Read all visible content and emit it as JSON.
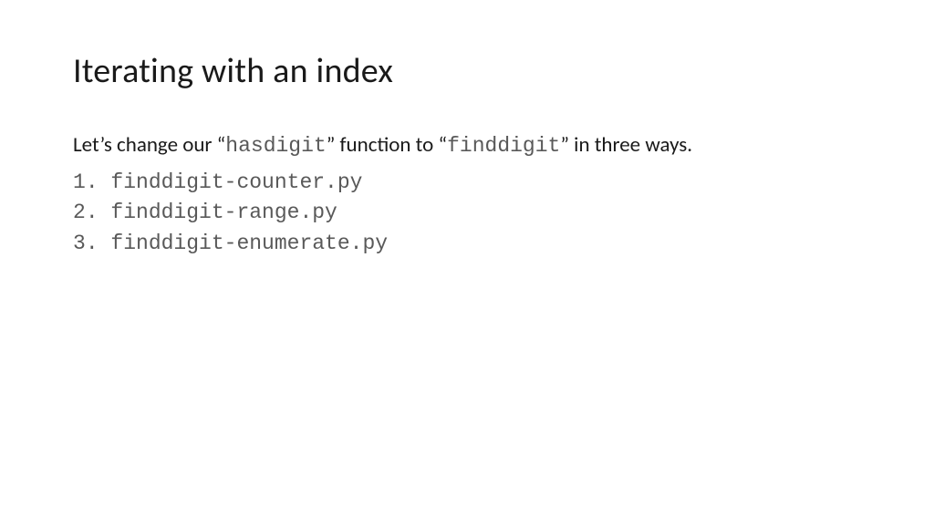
{
  "title": "Iterating with an index",
  "intro": {
    "pre": "Let’s change our “",
    "code1": "hasdigit",
    "mid": "” function to “",
    "code2": "finddigit",
    "post": "” in three ways."
  },
  "list": {
    "items": [
      "finddigit-counter.py",
      "finddigit-range.py",
      "finddigit-enumerate.py"
    ]
  }
}
